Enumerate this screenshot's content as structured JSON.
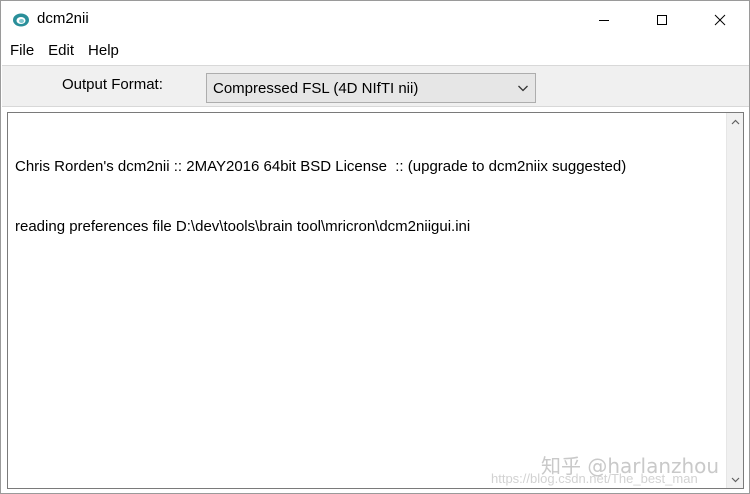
{
  "window": {
    "title": "dcm2nii",
    "app_icon": "dcm2nii-app-icon",
    "controls": {
      "minimize_icon": "minimize-icon",
      "maximize_icon": "maximize-icon",
      "close_icon": "close-icon"
    }
  },
  "menu": {
    "items": [
      {
        "label": "File"
      },
      {
        "label": "Edit"
      },
      {
        "label": "Help"
      }
    ]
  },
  "toolbar": {
    "output_format_label": "Output Format:",
    "output_format_value": "Compressed FSL (4D NIfTI nii)",
    "dropdown_icon": "chevron-down-icon"
  },
  "log": {
    "lines": [
      "Chris Rorden's dcm2nii :: 2MAY2016 64bit BSD License  :: (upgrade to dcm2niix suggested)",
      "reading preferences file D:\\dev\\tools\\brain tool\\mricron\\dcm2niigui.ini"
    ]
  },
  "watermark": {
    "line1": "知乎 @harlanzhou",
    "line2": "https://blog.csdn.net/The_best_man"
  },
  "colors": {
    "toolbar_bg": "#f0f0f0",
    "select_bg": "#e6e6e6",
    "icon_teal": "#2a8f9a"
  }
}
